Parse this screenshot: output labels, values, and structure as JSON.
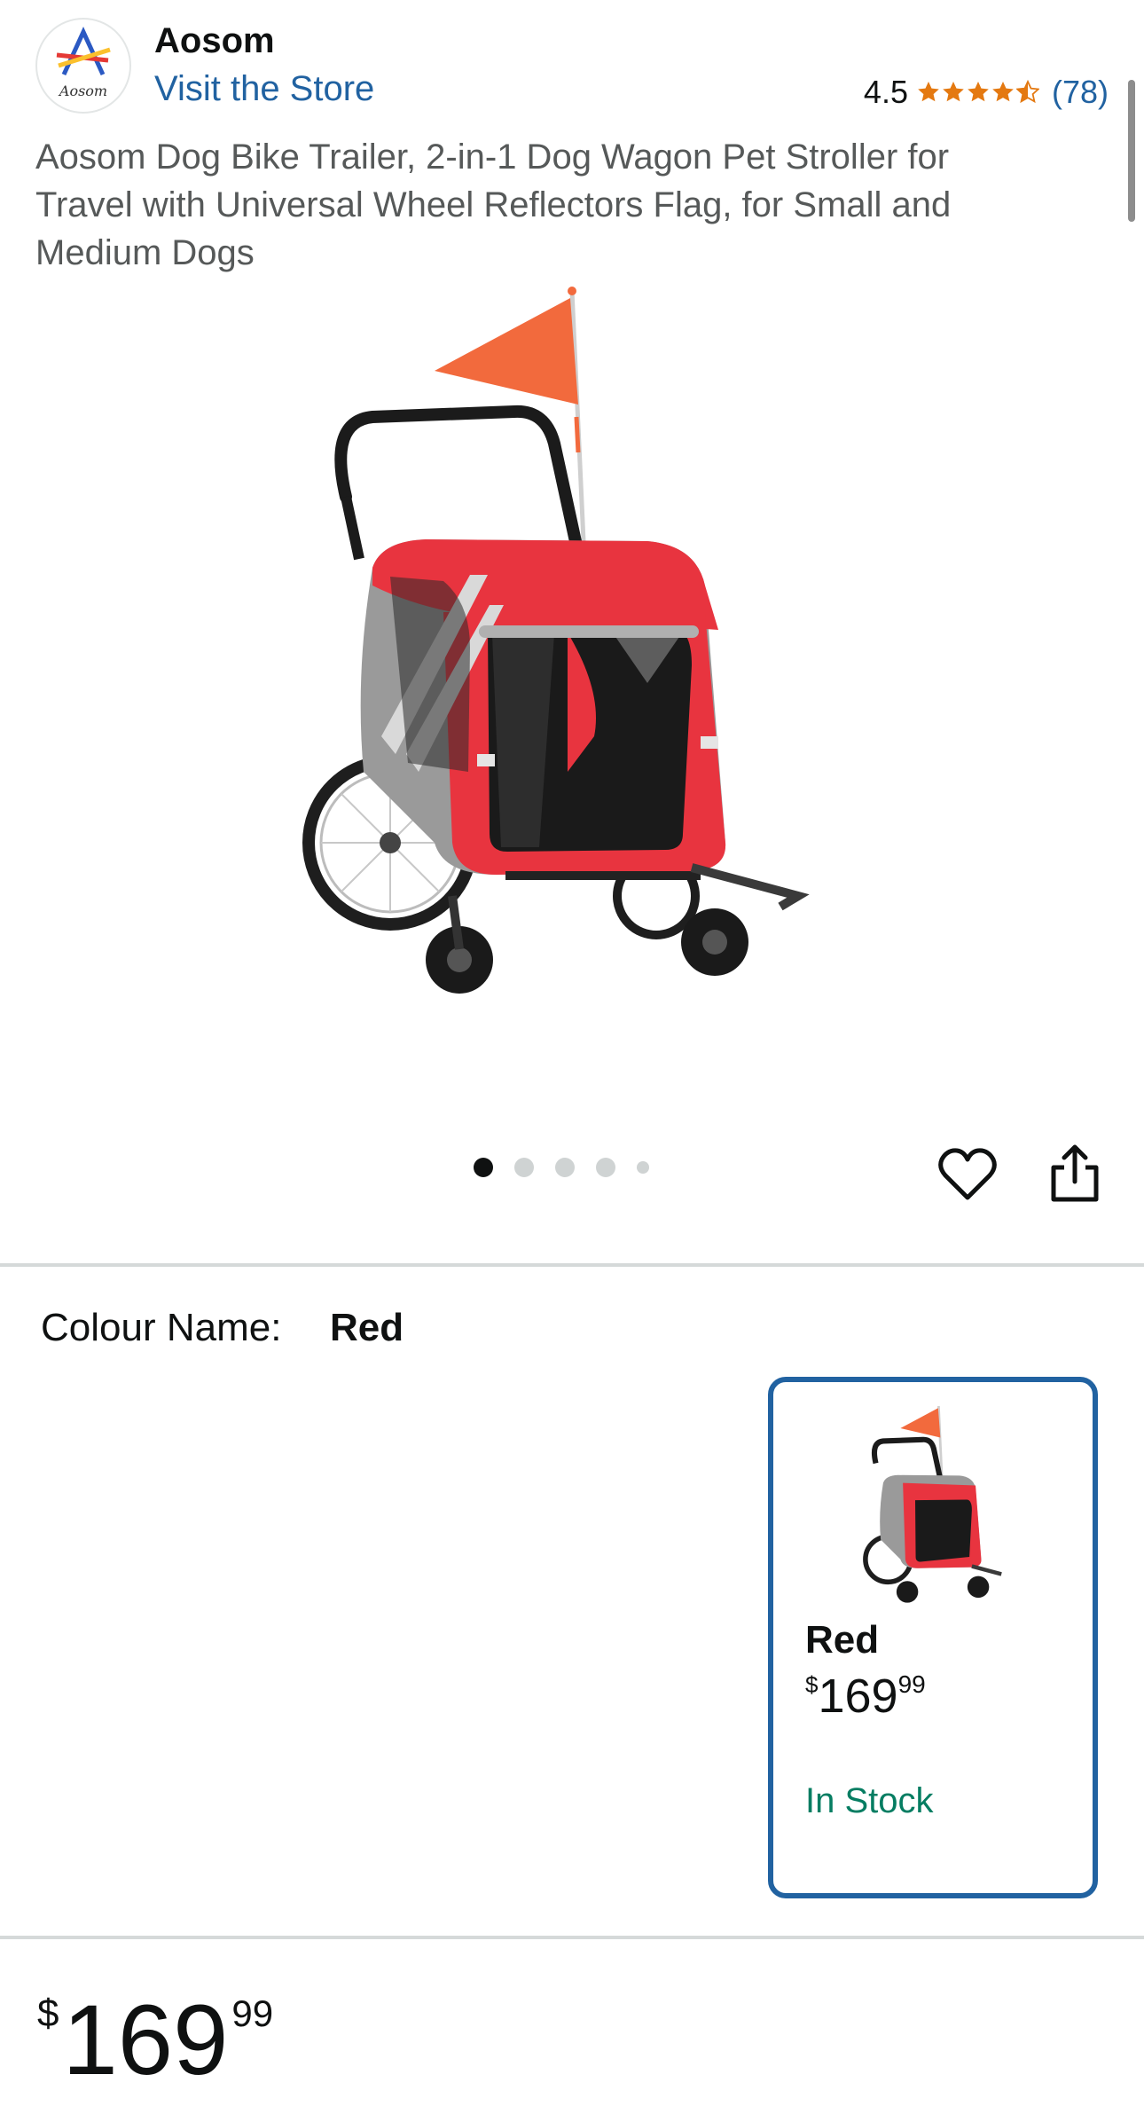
{
  "header": {
    "brand_name": "Aosom",
    "logo_text": "Aosom",
    "store_link": "Visit the Store",
    "rating_value": "4.5",
    "rating_stars": 4.5,
    "rating_count": "(78)"
  },
  "product": {
    "title": "Aosom Dog Bike Trailer, 2-in-1 Dog Wagon Pet Stroller for Travel with Universal Wheel Reflectors Flag, for Small and Medium Dogs",
    "image_icon": "dog-bike-trailer-image",
    "image_count": 5,
    "active_image": 1
  },
  "actions": {
    "wishlist_icon": "heart-icon",
    "share_icon": "share-icon"
  },
  "variation": {
    "label": "Colour Name:",
    "selected": "Red",
    "options": [
      {
        "name": "Red",
        "currency": "$",
        "price_whole": "169",
        "price_fraction": "99",
        "availability": "In Stock"
      }
    ]
  },
  "price": {
    "currency": "$",
    "whole": "169",
    "fraction": "99"
  },
  "colors": {
    "link": "#2162a1",
    "star": "#e47911",
    "in_stock": "#067d62",
    "selected_border": "#2162a1"
  }
}
